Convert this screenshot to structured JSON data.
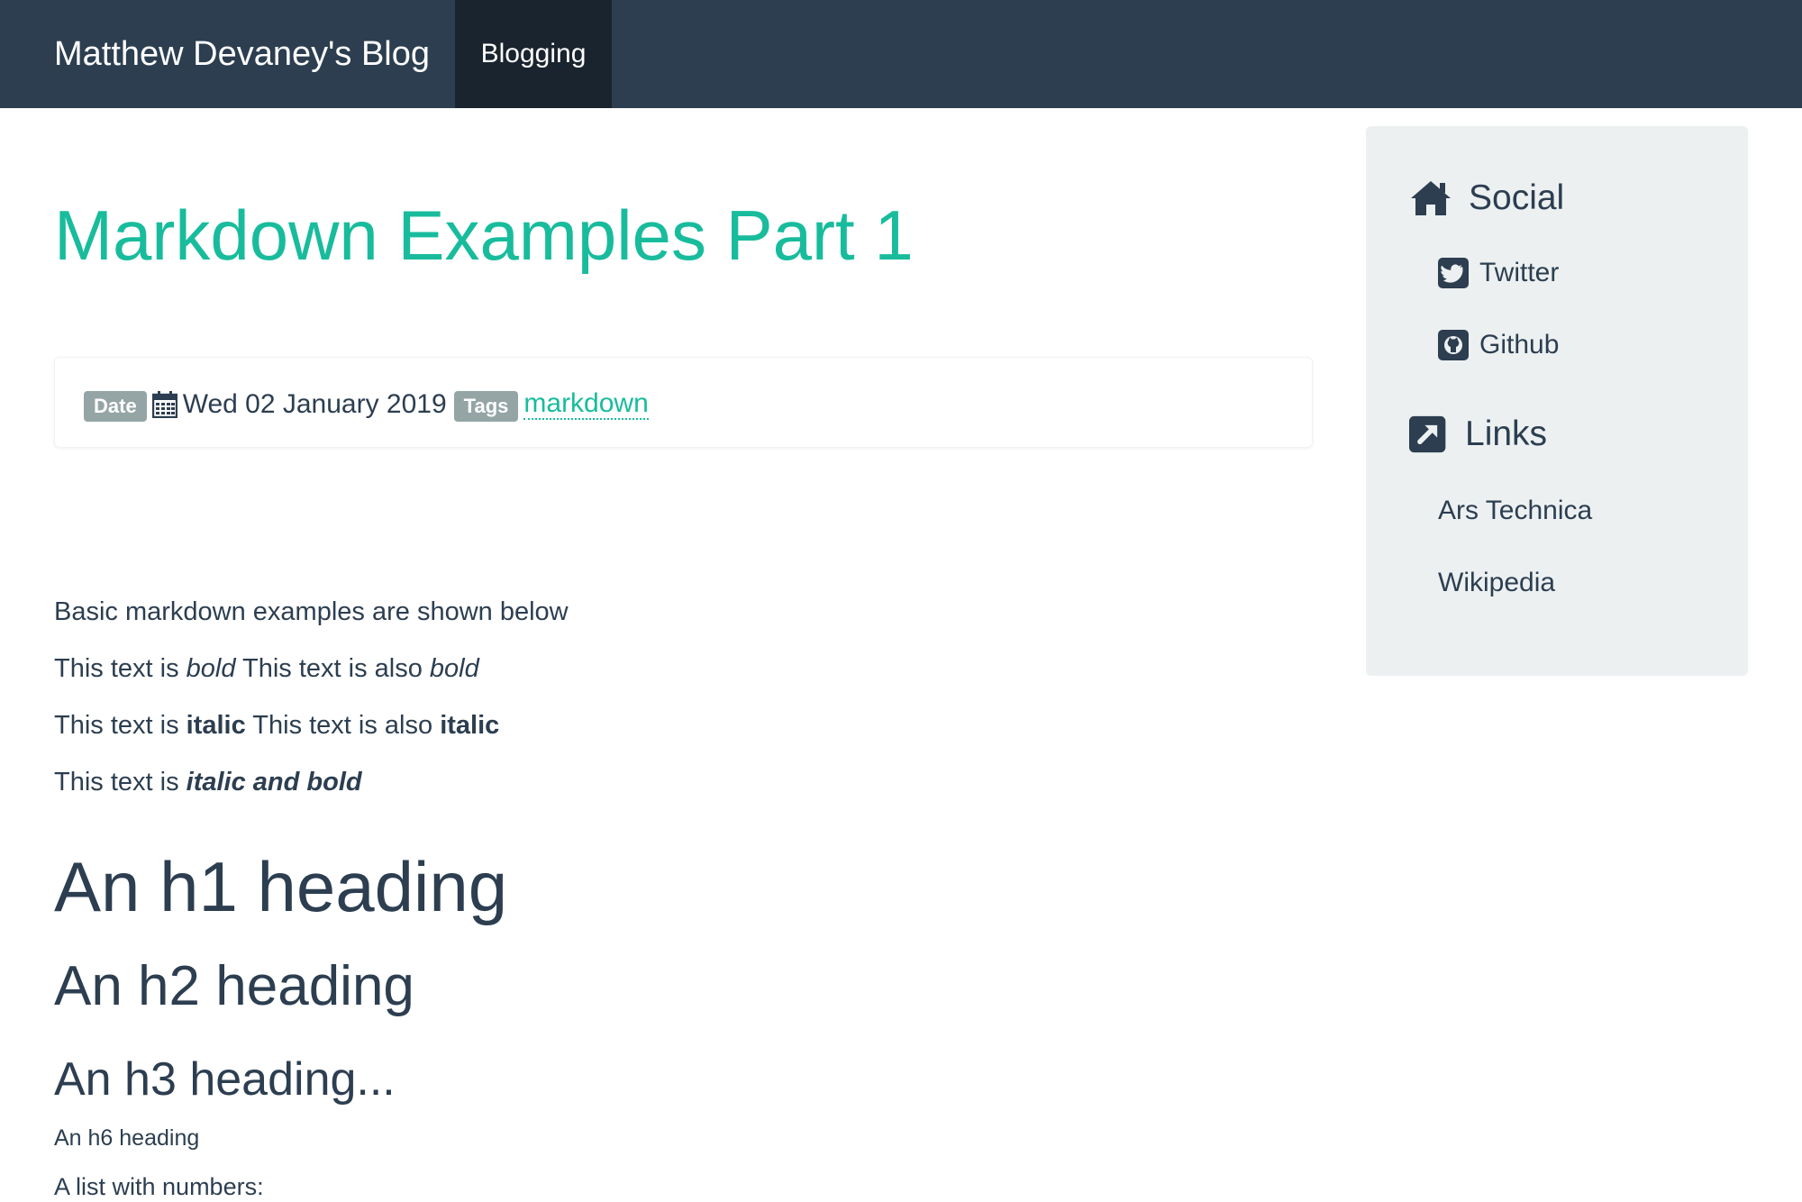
{
  "navbar": {
    "brand": "Matthew Devaney's Blog",
    "nav_items": [
      "Blogging"
    ]
  },
  "post": {
    "title": "Markdown Examples Part 1",
    "meta": {
      "date_label": "Date",
      "date_icon": "calendar-icon",
      "date": "Wed 02 January 2019",
      "tags_label": "Tags",
      "tags": [
        "markdown"
      ]
    },
    "content": {
      "intro": "Basic markdown examples are shown below",
      "bold_line": {
        "prefix1": "This text is ",
        "text1": "bold",
        "prefix2": " This text is also ",
        "text2": "bold"
      },
      "italic_line": {
        "prefix1": "This text is ",
        "text1": "italic",
        "prefix2": " This text is also ",
        "text2": "italic"
      },
      "bold_italic_line": {
        "prefix": "This text is ",
        "text": "italic and bold"
      },
      "h1": "An h1 heading",
      "h2": "An h2 heading",
      "h3": "An h3 heading...",
      "h6": "An h6 heading",
      "list_intro": "A list with numbers:"
    }
  },
  "sidebar": {
    "social": {
      "heading": "Social",
      "icon": "home-icon",
      "links": [
        {
          "label": "Twitter",
          "icon": "twitter-icon"
        },
        {
          "label": "Github",
          "icon": "github-icon"
        }
      ]
    },
    "links": {
      "heading": "Links",
      "icon": "external-link-icon",
      "items": [
        "Ars Technica",
        "Wikipedia"
      ]
    }
  },
  "colors": {
    "navbar_bg": "#2c3e50",
    "nav_active_bg": "#1a242f",
    "accent": "#18bc9c",
    "text": "#2c3e50",
    "label_bg": "#95a5a6",
    "sidebar_bg": "#ecf0f1"
  }
}
